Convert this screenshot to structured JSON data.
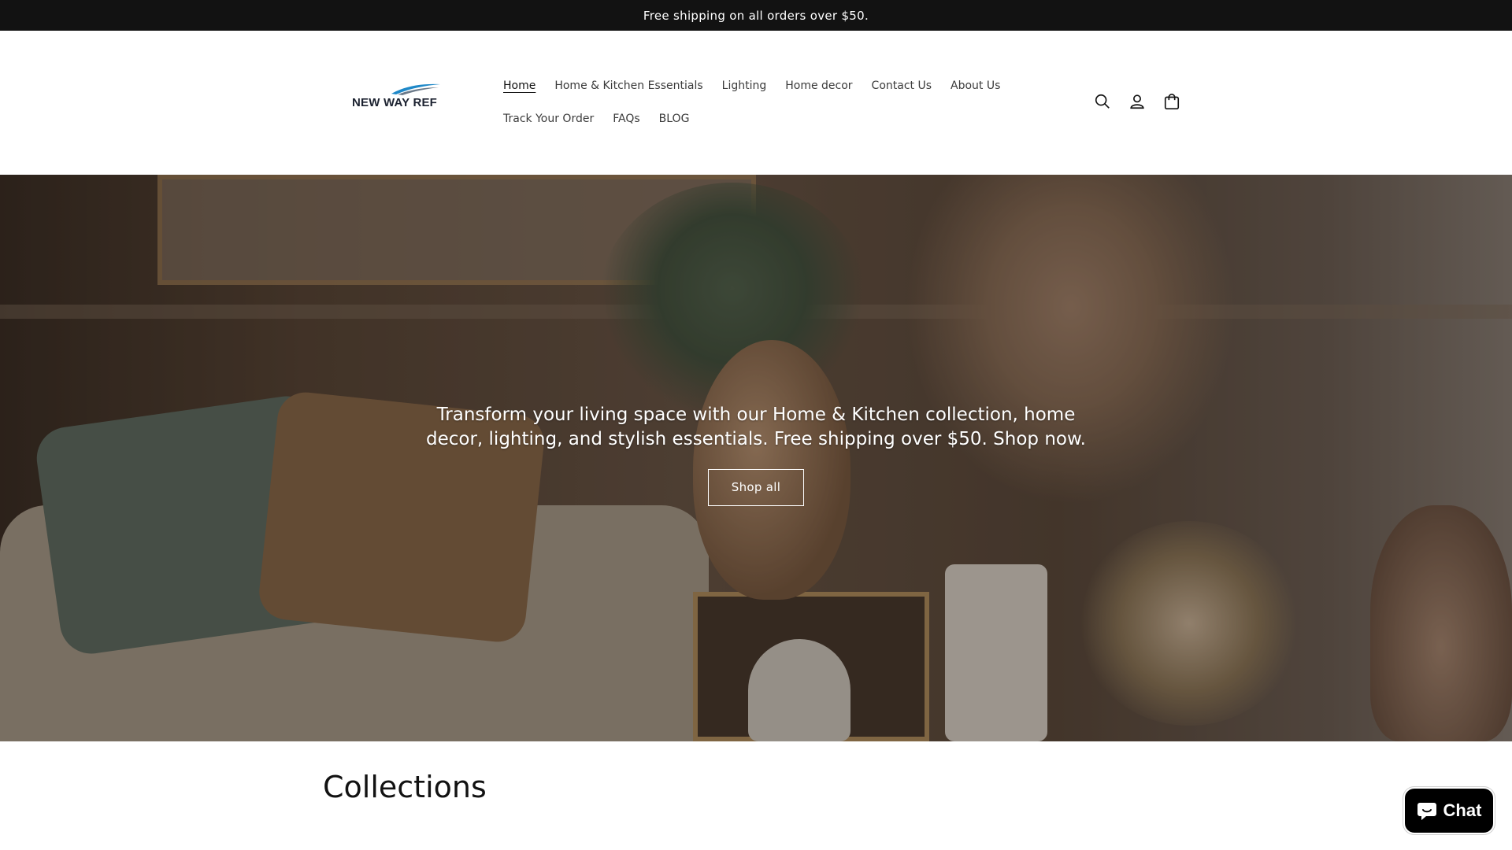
{
  "announcement": {
    "text": "Free shipping on all orders over $50."
  },
  "header": {
    "logo_text": "NEW WAY REF",
    "nav_row_1": [
      {
        "label": "Home",
        "active": true
      },
      {
        "label": "Home & Kitchen Essentials"
      },
      {
        "label": "Lighting"
      },
      {
        "label": "Home decor"
      },
      {
        "label": "Contact Us"
      },
      {
        "label": "About Us"
      }
    ],
    "nav_row_2": [
      {
        "label": "Track Your Order"
      },
      {
        "label": "FAQs"
      },
      {
        "label": "BLOG"
      }
    ],
    "icons": [
      "search-icon",
      "account-icon",
      "cart-icon"
    ]
  },
  "hero": {
    "text": "Transform your living space with our Home & Kitchen collection, home decor, lighting, and stylish essentials. Free shipping over $50. Shop now.",
    "button_label": "Shop all"
  },
  "collections": {
    "title": "Collections"
  },
  "chat": {
    "label": "Chat"
  },
  "colors": {
    "announcement_bg": "#121212",
    "text": "#121212",
    "chat_bg": "#000000",
    "logo_accent": "#1e88c8"
  }
}
